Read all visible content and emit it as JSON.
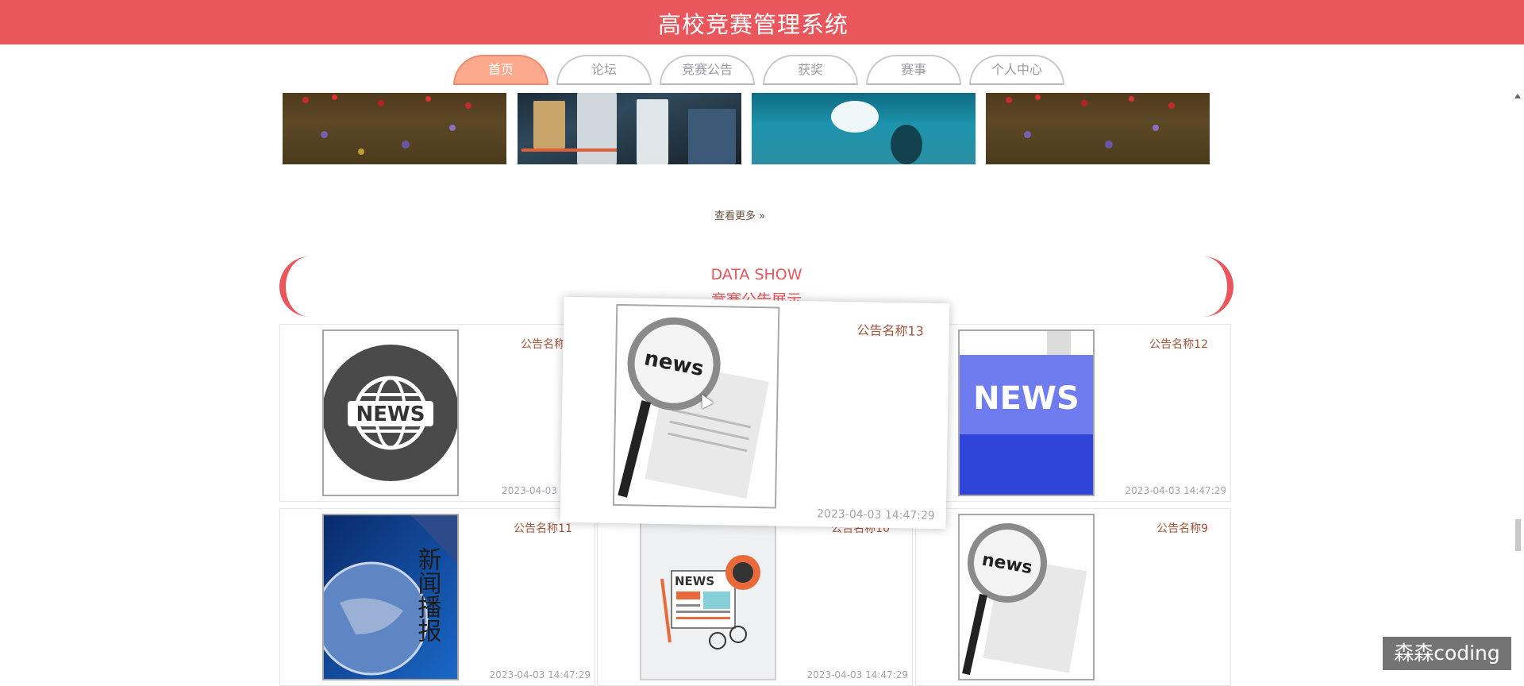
{
  "header": {
    "title": "高校竞赛管理系统",
    "color": "#e9575c"
  },
  "nav": {
    "items": [
      {
        "label": "首页",
        "active": true
      },
      {
        "label": "论坛"
      },
      {
        "label": "竞赛公告"
      },
      {
        "label": "获奖"
      },
      {
        "label": "赛事"
      },
      {
        "label": "个人中心"
      }
    ]
  },
  "more_link": "查看更多 »",
  "section": {
    "title_en": "DATA SHOW",
    "title_cn": "竞赛公告展示"
  },
  "cards": [
    {
      "title": "公告名称1",
      "time": "2023-04-03 14",
      "image": "globe-news-image"
    },
    {
      "title": "公告名称13",
      "time": "2023-04-03 14:47:29",
      "image": "magnifier-news-image"
    },
    {
      "title": "公告名称12",
      "time": "2023-04-03 14:47:29",
      "image": "news-key-image"
    },
    {
      "title": "公告名称11",
      "time": "2023-04-03 14:47:29",
      "image": "world-news-image"
    },
    {
      "title": "公告名称10",
      "time": "2023-04-03 14:47:29",
      "image": "newspaper-illustration-image"
    },
    {
      "title": "公告名称9",
      "time": "",
      "image": "magnifier-news-image"
    }
  ],
  "news_labels": {
    "globe": "NEWS",
    "key": "NEWS",
    "magnifier": "news",
    "illustration": "NEWS",
    "world_cn": "新闻播报"
  },
  "watermark": "森森coding"
}
